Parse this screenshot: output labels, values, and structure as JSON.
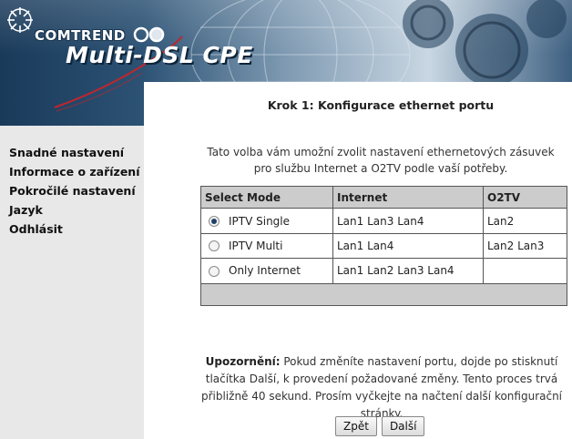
{
  "brand": {
    "company": "COMTREND",
    "product": "Multi-DSL CPE"
  },
  "sidebar": {
    "items": [
      {
        "label": "Snadné nastavení"
      },
      {
        "label": "Informace o zařízení"
      },
      {
        "label": "Pokročilé nastavení"
      },
      {
        "label": "Jazyk"
      },
      {
        "label": "Odhlásit"
      }
    ]
  },
  "main": {
    "title": "Krok 1: Konfigurace ethernet portu",
    "intro": "Tato volba vám umožní zvolit nastavení ethernetových zásuvek pro službu Internet a O2TV podle vaší potřeby.",
    "table": {
      "headers": [
        "Select Mode",
        "Internet",
        "O2TV"
      ],
      "rows": [
        {
          "mode": "IPTV Single",
          "internet": "Lan1 Lan3 Lan4",
          "o2tv": "Lan2",
          "selected": true
        },
        {
          "mode": "IPTV Multi",
          "internet": "Lan1 Lan4",
          "o2tv": "Lan2 Lan3",
          "selected": false
        },
        {
          "mode": "Only Internet",
          "internet": "Lan1 Lan2 Lan3 Lan4",
          "o2tv": "",
          "selected": false
        }
      ]
    },
    "warning_label": "Upozornění:",
    "warning_text": " Pokud změníte nastavení portu, dojde po stisknutí tlačítka Další, k provedení požadované změny. Tento proces trvá přibližně 40 sekund. Prosím vyčkejte na načtení další konfigurační stránky.",
    "buttons": {
      "back": "Zpět",
      "next": "Další"
    }
  },
  "colors": {
    "banner_dark": "#1c3a58",
    "banner_light": "#c9d7e3",
    "accent_red": "#c0262d",
    "sidebar_bg": "#e8e8e8",
    "table_header_bg": "#cccccc"
  }
}
